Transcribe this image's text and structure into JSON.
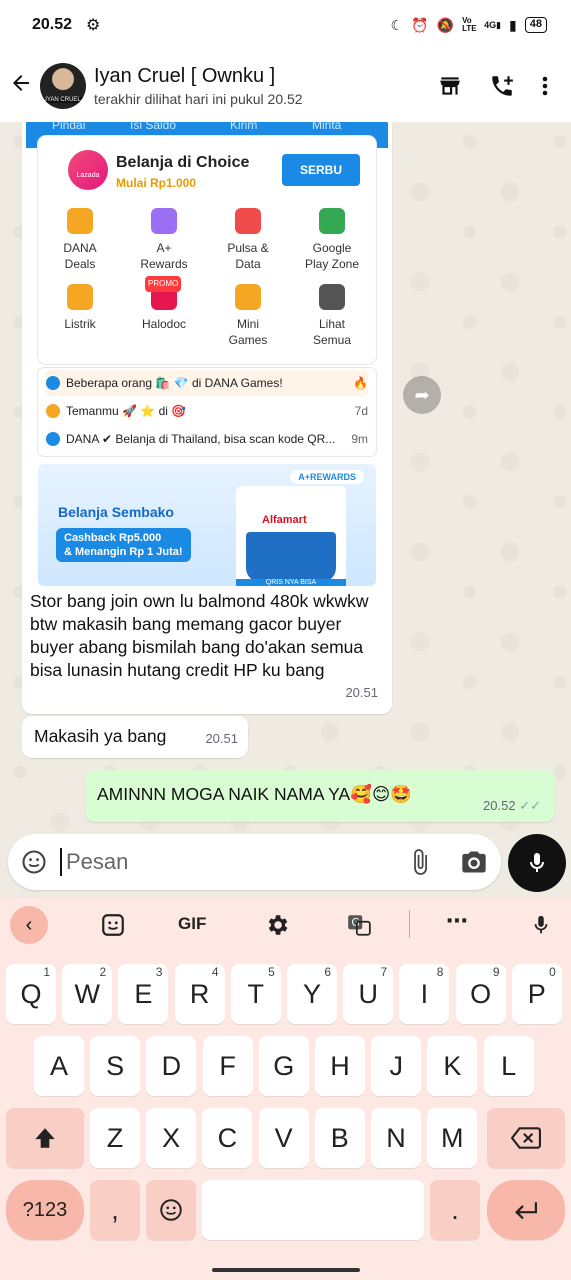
{
  "status_bar": {
    "time": "20.52",
    "battery": "48",
    "net_label": "4G",
    "volte": "Vo LTE"
  },
  "header": {
    "name": "Iyan Cruel [ Ownku ]",
    "status": "terakhir dilihat hari ini pukul 20.52",
    "icons": [
      "back-arrow-icon",
      "store-icon",
      "add-call-icon",
      "more-vert-icon"
    ]
  },
  "dana_screenshot": {
    "top_tabs": [
      "Pindai",
      "Isi Saldo",
      "Kirim",
      "Minta"
    ],
    "lazada_logo": "Lazada CHOICE",
    "promo_title": "Belanja di Choice",
    "promo_sub": "Mulai Rp1.000",
    "promo_button": "SERBU",
    "services": [
      {
        "l1": "DANA",
        "l2": "Deals",
        "color": "#f5a623"
      },
      {
        "l1": "A+",
        "l2": "Rewards",
        "color": "#9b6ef3"
      },
      {
        "l1": "Pulsa &",
        "l2": "Data",
        "color": "#ef4b4b"
      },
      {
        "l1": "Google",
        "l2": "Play Zone",
        "color": "#34a853"
      },
      {
        "l1": "Listrik",
        "l2": "",
        "color": "#f5a623"
      },
      {
        "l1": "Halodoc",
        "l2": "",
        "color": "#e6174f",
        "badge": "PROMO"
      },
      {
        "l1": "Mini",
        "l2": "Games",
        "color": "#f5a623"
      },
      {
        "l1": "Lihat",
        "l2": "Semua",
        "color": "#555555"
      }
    ],
    "notifications": [
      {
        "text": "Beberapa orang 🛍️ 💎 di DANA Games!",
        "ts": "🔥"
      },
      {
        "text": "Temanmu 🚀 ⭐ di 🎯",
        "ts": "7d"
      },
      {
        "text": "DANA ✔ Belanja di Thailand, bisa scan kode QR...",
        "ts": "9m"
      }
    ],
    "banner": {
      "tag": "A+REWARDS",
      "title": "Belanja Sembako",
      "line1": "Cashback Rp5.000",
      "line2": "& Menangin Rp 1 Juta!",
      "store": "Alfamart",
      "footer": "QRIS NYA BISA"
    }
  },
  "messages": {
    "caption": "Stor bang join own lu balmond 480k wkwkw btw makasih bang memang gacor buyer buyer abang bismilah bang do'akan semua bisa lunasin hutang credit HP ku bang",
    "caption_time": "20.51",
    "msg2": "Makasih ya bang",
    "msg2_time": "20.51",
    "out": "AMINNN MOGA NAIK NAMA YA🥰😊🤩",
    "out_time": "20.52",
    "out_ticks": "✓✓"
  },
  "input": {
    "placeholder": "Pesan"
  },
  "keyboard": {
    "toolbar": [
      "GIF"
    ],
    "row1": [
      [
        "Q",
        "1"
      ],
      [
        "W",
        "2"
      ],
      [
        "E",
        "3"
      ],
      [
        "R",
        "4"
      ],
      [
        "T",
        "5"
      ],
      [
        "Y",
        "6"
      ],
      [
        "U",
        "7"
      ],
      [
        "I",
        "8"
      ],
      [
        "O",
        "9"
      ],
      [
        "P",
        "0"
      ]
    ],
    "row2": [
      "A",
      "S",
      "D",
      "F",
      "G",
      "H",
      "J",
      "K",
      "L"
    ],
    "row3": [
      "Z",
      "X",
      "C",
      "V",
      "B",
      "N",
      "M"
    ],
    "sym": "?123",
    "comma": ",",
    "period": "."
  }
}
